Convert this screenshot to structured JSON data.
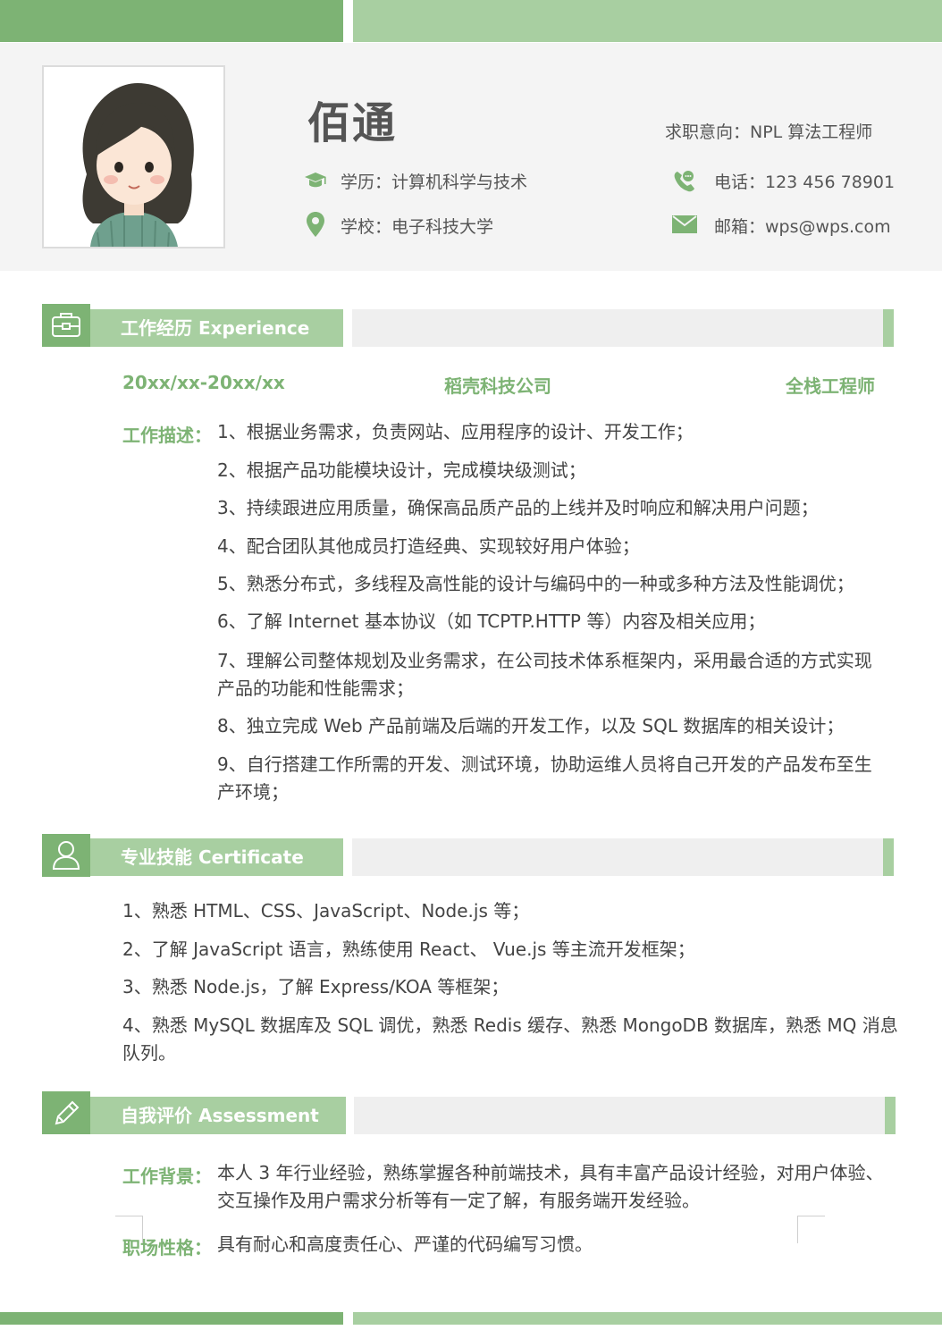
{
  "profile": {
    "name": "佰通",
    "job_intent": "求职意向：NPL 算法工程师",
    "education": "学历：计算机科学与技术",
    "school": "学校：电子科技大学",
    "phone": "电话：123 456 78901",
    "email": "邮箱：wps@wps.com"
  },
  "colors": {
    "accent_dark": "#7db374",
    "accent_light": "#a8cfa1",
    "header_bg": "#f4f4f4",
    "section_gray": "#efefef"
  },
  "icons": [
    "graduation-cap-icon",
    "location-pin-icon",
    "phone-icon",
    "mail-icon",
    "briefcase-icon",
    "user-icon",
    "pencil-icon"
  ],
  "experience": {
    "title": "工作经历  Experience",
    "period": "20xx/xx-20xx/xx",
    "company": "稻壳科技公司",
    "position": "全栈工程师",
    "desc_label": "工作描述：",
    "items": [
      "1、根据业务需求，负责网站、应用程序的设计、开发工作；",
      "2、根据产品功能模块设计，完成模块级测试；",
      "3、持续跟进应用质量，确保高品质产品的上线并及时响应和解决用户问题；",
      "4、配合团队其他成员打造经典、实现较好用户体验；",
      "5、熟悉分布式，多线程及高性能的设计与编码中的一种或多种方法及性能调优；",
      "6、了解 Internet 基本协议（如 TCPTP.HTTP 等）内容及相关应用；",
      "7、理解公司整体规划及业务需求，在公司技术体系框架内，采用最合适的方式实现产品的功能和性能需求；",
      "8、独立完成 Web 产品前端及后端的开发工作，以及 SQL 数据库的相关设计；",
      "9、自行搭建工作所需的开发、测试环境，协助运维人员将自己开发的产品发布至生产环境；"
    ]
  },
  "skills": {
    "title": "专业技能  Certificate",
    "items": [
      "1、熟悉  HTML、CSS、JavaScript、Node.js  等；",
      "2、了解  JavaScript  语言，熟练使用  React、  Vue.js  等主流开发框架；",
      "3、熟悉  Node.js，了解  Express/KOA  等框架；",
      "4、熟悉 MySQL 数据库及 SQL 调优，熟悉 Redis 缓存、熟悉 MongoDB 数据库，熟悉 MQ 消息队列。"
    ]
  },
  "assessment": {
    "title": "自我评价  Assessment",
    "background_label": "工作背景：",
    "background_text": "本人 3 年行业经验，熟练掌握各种前端技术，具有丰富产品设计经验，对用户体验、交互操作及用户需求分析等有一定了解，有服务端开发经验。",
    "personality_label": "职场性格：",
    "personality_text": "具有耐心和高度责任心、严谨的代码编写习惯。"
  }
}
